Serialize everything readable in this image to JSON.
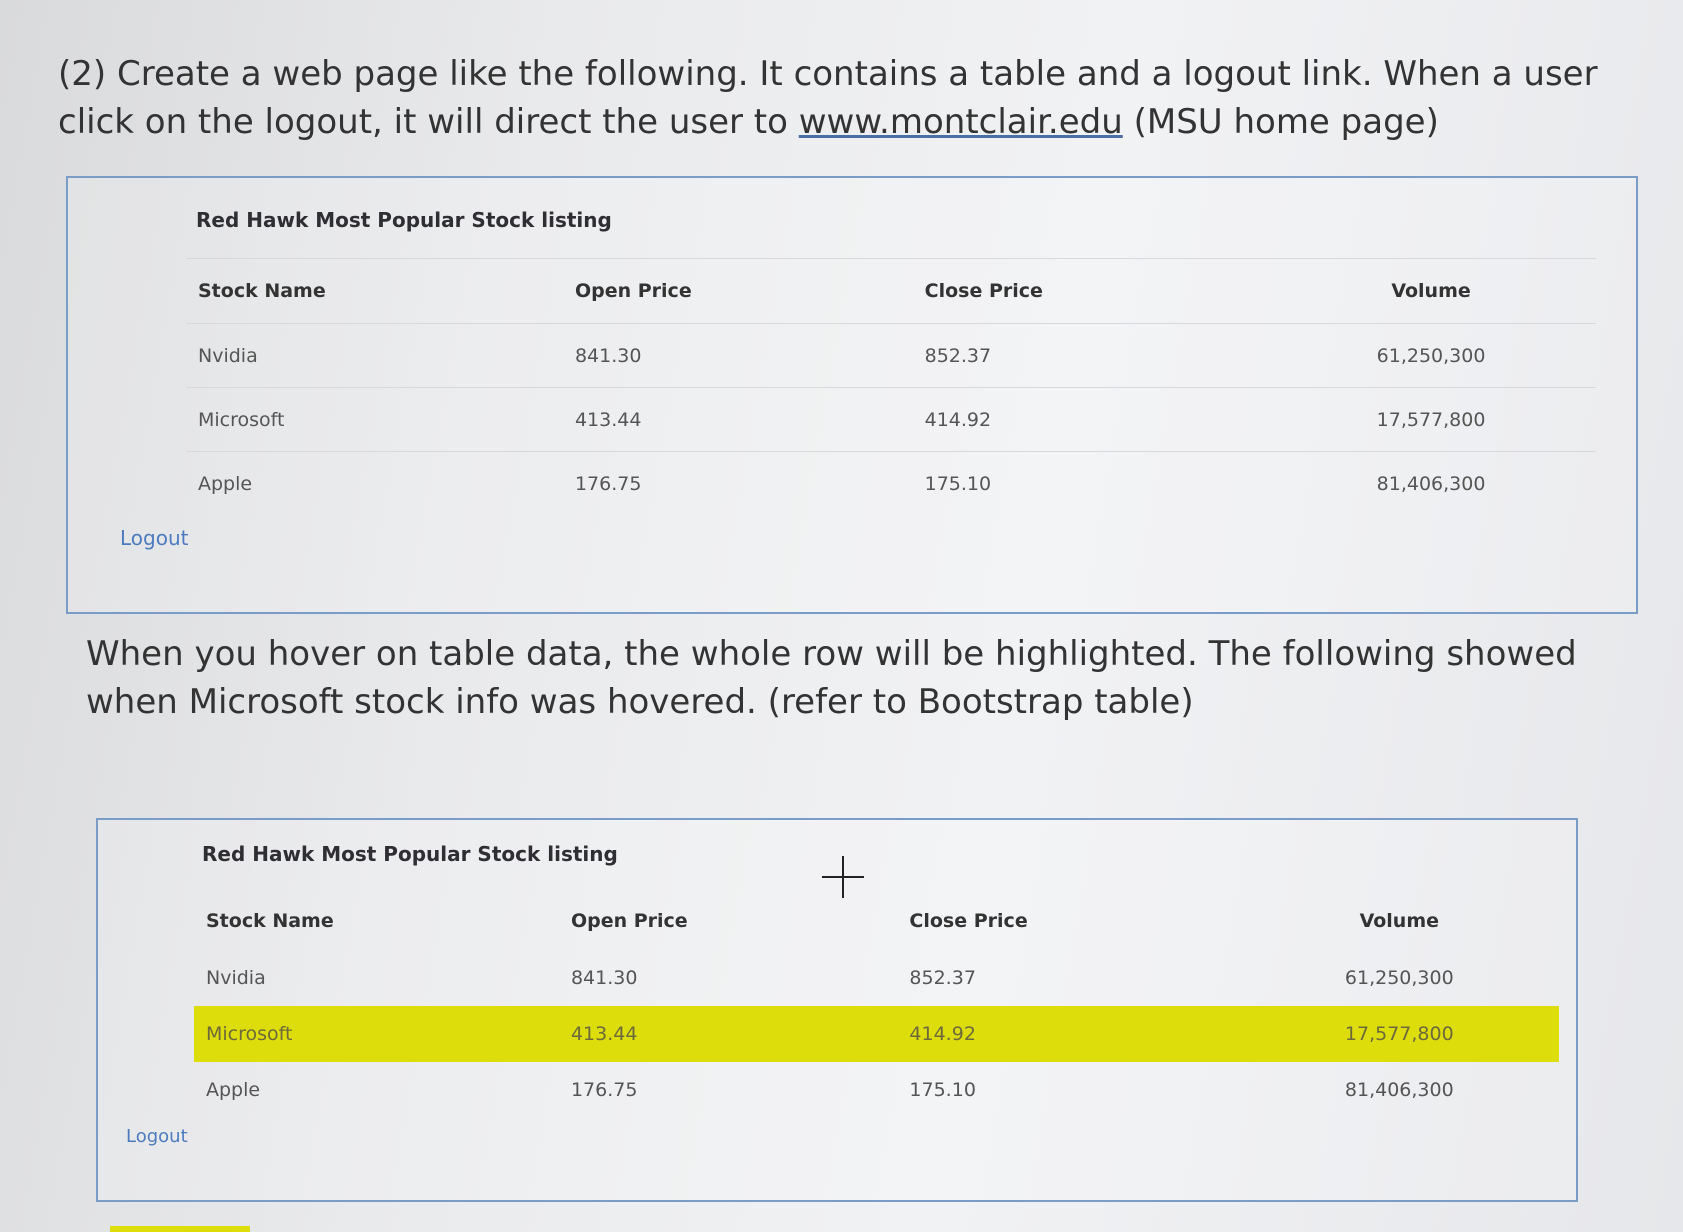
{
  "intro": {
    "text_before_link": "(2) Create a web page like the following. It contains a table and a logout link. When a user click on the logout, it will direct the user to ",
    "link_text": "www.montclair.edu",
    "text_after_link": " (MSU home page)"
  },
  "hover_note": "When you hover on table data, the whole row will be highlighted. The following showed when Microsoft stock info was hovered. (refer to Bootstrap table)",
  "table": {
    "title": "Red Hawk Most Popular Stock listing",
    "headers": [
      "Stock Name",
      "Open Price",
      "Close Price",
      "Volume"
    ],
    "rows": [
      [
        "Nvidia",
        "841.30",
        "852.37",
        "61,250,300"
      ],
      [
        "Microsoft",
        "413.44",
        "414.92",
        "17,577,800"
      ],
      [
        "Apple",
        "176.75",
        "175.10",
        "81,406,300"
      ]
    ]
  },
  "logout_label": "Logout",
  "colors": {
    "highlight": "#dedd0c",
    "link": "#4d7bbf",
    "panel_border": "#7a9cc6"
  },
  "icons": {
    "cursor": "crosshair-cursor-icon"
  }
}
